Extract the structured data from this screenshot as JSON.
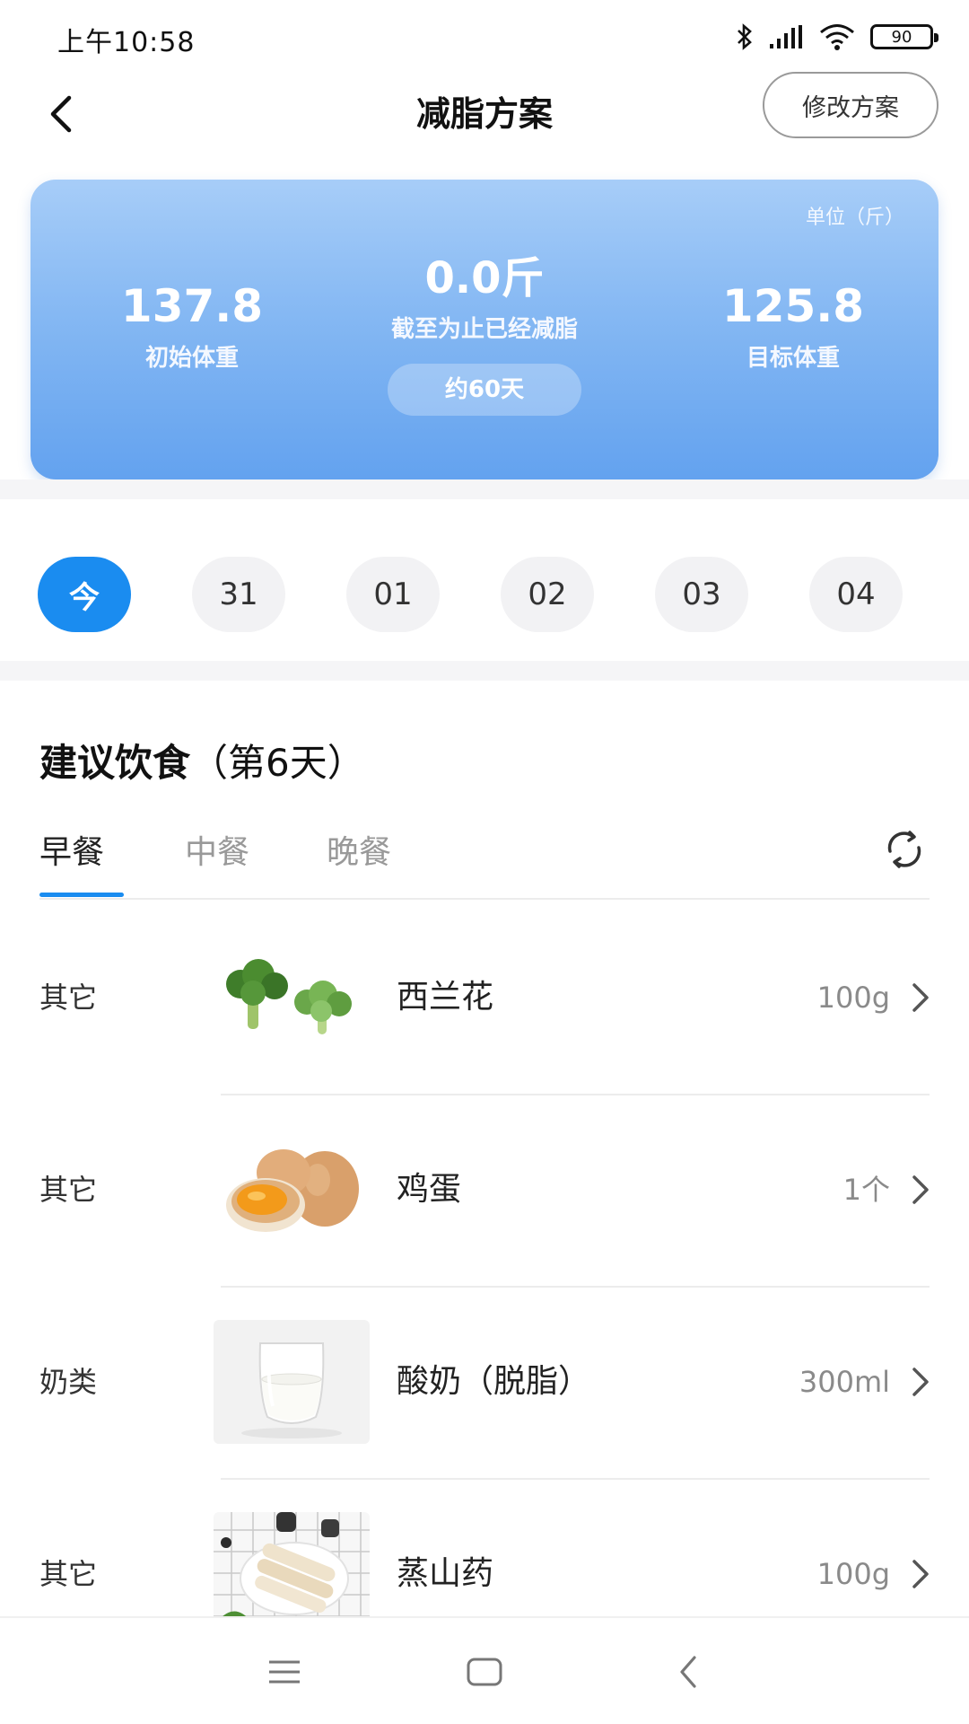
{
  "status_bar": {
    "time": "上午10:58",
    "battery": "90",
    "icons": [
      "bluetooth-icon",
      "signal-icon",
      "wifi-icon",
      "battery-icon"
    ]
  },
  "header": {
    "title": "减脂方案",
    "edit_button": "修改方案",
    "back_icon": "chevron-left-icon"
  },
  "summary": {
    "unit": "单位（斤）",
    "start_weight": "137.8",
    "start_label": "初始体重",
    "lost_value": "0.0斤",
    "lost_label": "截至为止已经减脂",
    "duration": "约60天",
    "target_weight": "125.8",
    "target_label": "目标体重"
  },
  "dates": [
    "今",
    "31",
    "01",
    "02",
    "03",
    "04"
  ],
  "diet": {
    "title": "建议饮食",
    "day_label": "（第6天）",
    "tabs": [
      "早餐",
      "中餐",
      "晚餐"
    ],
    "active_tab": "早餐",
    "refresh_icon": "refresh-icon",
    "items": [
      {
        "category": "其它",
        "name": "西兰花",
        "amount": "100g",
        "image": "broccoli"
      },
      {
        "category": "其它",
        "name": "鸡蛋",
        "amount": "1个",
        "image": "eggs"
      },
      {
        "category": "奶类",
        "name": "酸奶（脱脂）",
        "amount": "300ml",
        "image": "yogurt"
      },
      {
        "category": "其它",
        "name": "蒸山药",
        "amount": "100g",
        "image": "yam"
      }
    ]
  },
  "nav_bar": {
    "icons": [
      "menu-icon",
      "home-icon",
      "back-icon"
    ]
  },
  "colors": {
    "accent": "#1a8cf0",
    "card_top": "#a7cdf8",
    "card_bottom": "#63a2ef"
  }
}
